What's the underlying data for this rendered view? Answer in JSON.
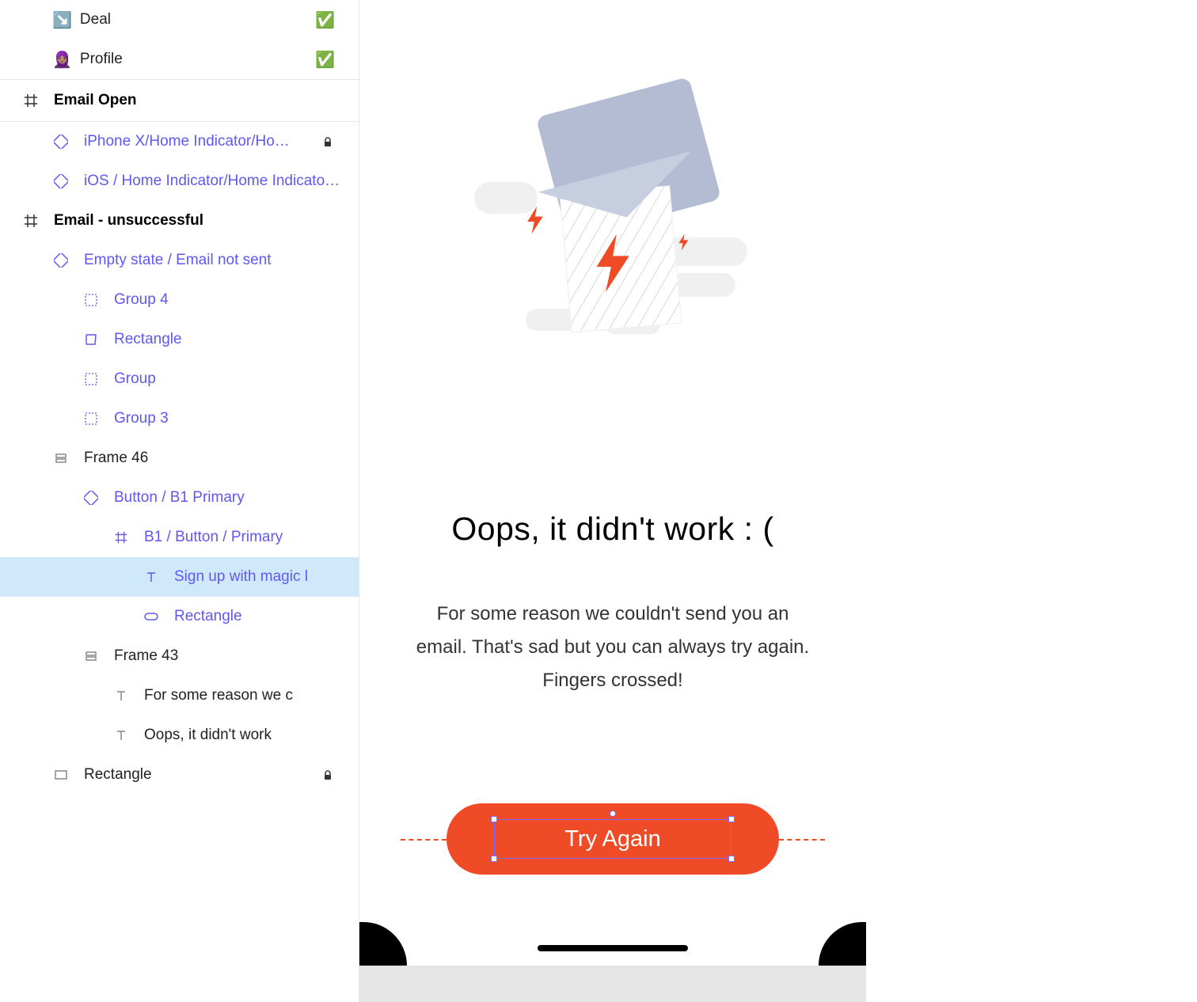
{
  "layers": {
    "deal": "Deal",
    "profile": "Profile",
    "email_open": "Email Open",
    "iphone_home": "iPhone X/Home Indicator/Ho…",
    "ios_home": "iOS / Home Indicator/Home Indicator -…",
    "email_unsuccessful": "Email - unsuccessful",
    "empty_state": "Empty state / Email not sent",
    "group_4": "Group 4",
    "rectangle_1": "Rectangle",
    "group": "Group",
    "group_3": "Group 3",
    "frame_46": "Frame 46",
    "button_b1": "Button / B1 Primary",
    "b1_button_primary": "B1 / Button / Primary",
    "signup_magic": "Sign up with magic l",
    "rectangle_2": "Rectangle",
    "frame_43": "Frame 43",
    "for_some_reason": "For some reason we c",
    "oops_didnt": "Oops, it didn't work",
    "rectangle_3": "Rectangle"
  },
  "emoji": {
    "deal_prefix": "↘️",
    "deal_suffix": "✅",
    "profile_prefix": "🧕🏽",
    "profile_suffix": "✅"
  },
  "canvas": {
    "title": "Oops, it didn't work : (",
    "body": "For some reason we couldn't send you an email. That's sad but you can always try again. Fingers crossed!",
    "cta": "Try Again"
  }
}
